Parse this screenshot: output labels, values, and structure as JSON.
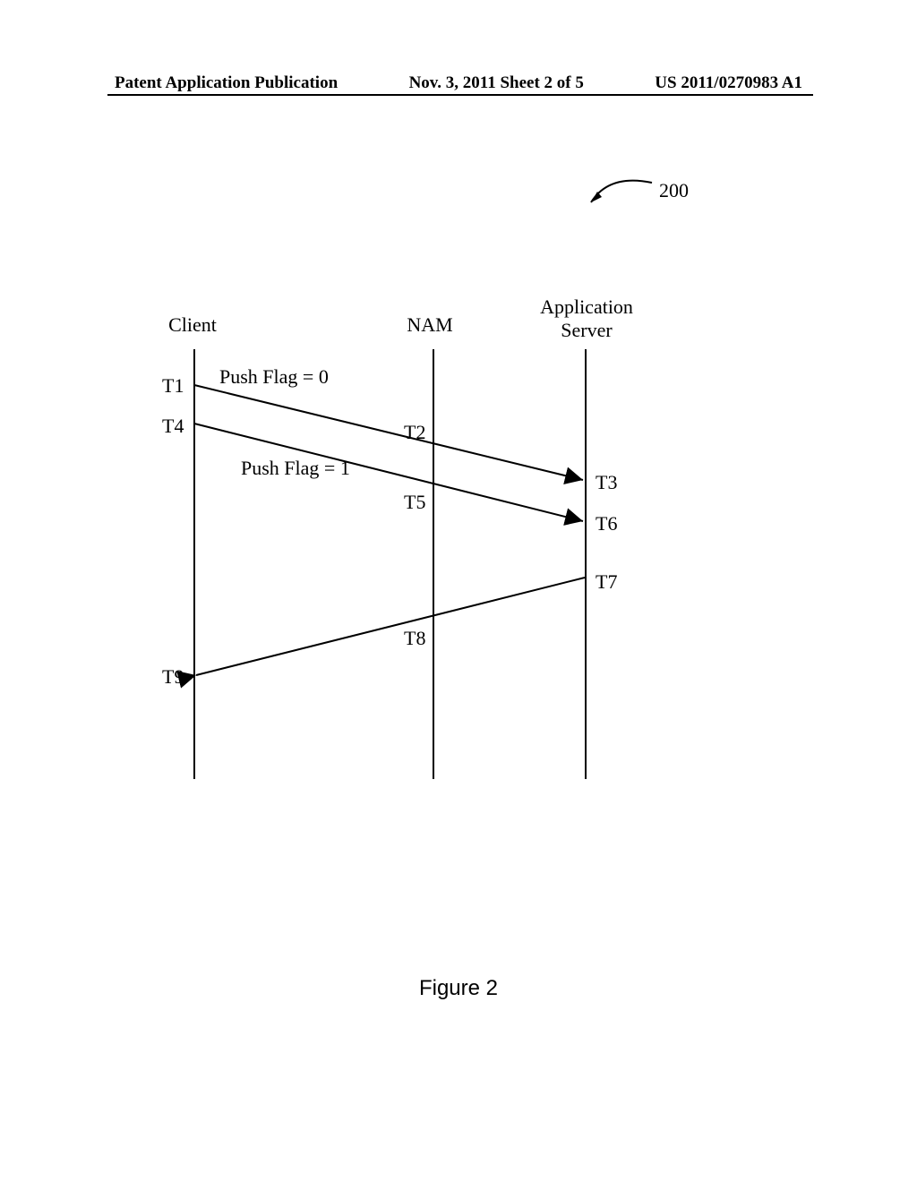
{
  "header": {
    "left": "Patent Application Publication",
    "center": "Nov. 3, 2011   Sheet 2 of 5",
    "right": "US 2011/0270983 A1"
  },
  "ref_label": "200",
  "lifelines": {
    "client": "Client",
    "nam": "NAM",
    "app_line1": "Application",
    "app_line2": "Server"
  },
  "time_labels": {
    "t1": "T1",
    "t2": "T2",
    "t3": "T3",
    "t4": "T4",
    "t5": "T5",
    "t6": "T6",
    "t7": "T7",
    "t8": "T8",
    "t9": "T9"
  },
  "messages": {
    "push0": "Push Flag = 0",
    "push1": "Push Flag = 1"
  },
  "caption": "Figure 2",
  "chart_data": {
    "type": "sequence-diagram",
    "lifelines": [
      "Client",
      "NAM",
      "Application Server"
    ],
    "events": [
      {
        "t": "T1",
        "lifeline": "Client"
      },
      {
        "t": "T2",
        "lifeline": "NAM"
      },
      {
        "t": "T3",
        "lifeline": "Application Server"
      },
      {
        "t": "T4",
        "lifeline": "Client"
      },
      {
        "t": "T5",
        "lifeline": "NAM"
      },
      {
        "t": "T6",
        "lifeline": "Application Server"
      },
      {
        "t": "T7",
        "lifeline": "Application Server"
      },
      {
        "t": "T8",
        "lifeline": "NAM"
      },
      {
        "t": "T9",
        "lifeline": "Client"
      }
    ],
    "messages": [
      {
        "from": "Client",
        "to": "Application Server",
        "label": "Push Flag = 0",
        "from_t": "T1",
        "via_t": "T2",
        "to_t": "T3"
      },
      {
        "from": "Client",
        "to": "Application Server",
        "label": "Push Flag = 1",
        "from_t": "T4",
        "via_t": "T5",
        "to_t": "T6"
      },
      {
        "from": "Application Server",
        "to": "Client",
        "label": "",
        "from_t": "T7",
        "via_t": "T8",
        "to_t": "T9"
      }
    ]
  }
}
